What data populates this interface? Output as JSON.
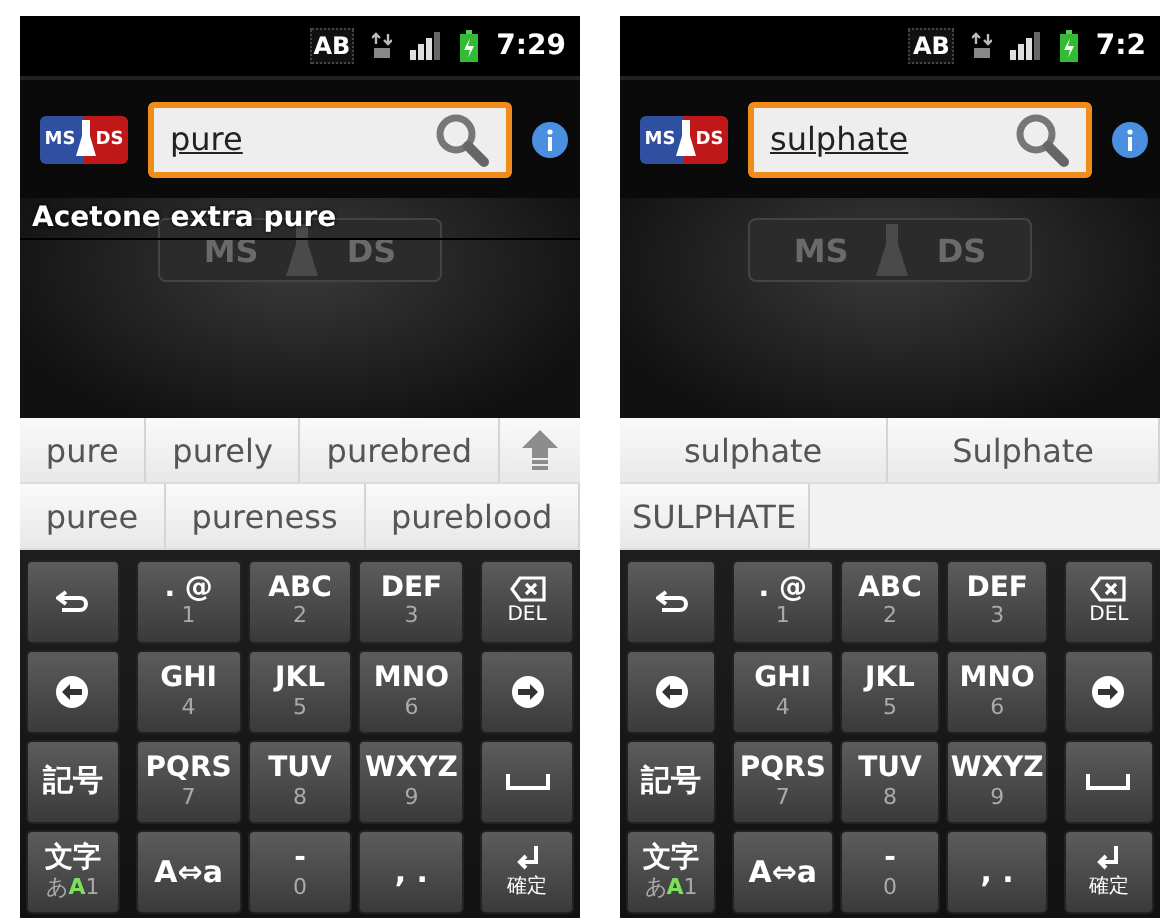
{
  "phones": [
    {
      "status": {
        "input_mode": "AB",
        "time": "7:29"
      },
      "logo": {
        "left": "MS",
        "right": "DS"
      },
      "search": {
        "value": "pure"
      },
      "results": [
        "Acetone extra pure"
      ],
      "background_logo": {
        "left": "MS",
        "right": "DS"
      },
      "suggestions": [
        {
          "words": [
            "pure",
            "purely",
            "purebred"
          ],
          "expand_button": true
        },
        {
          "words": [
            "puree",
            "pureness",
            "pureblood"
          ],
          "expand_button": false
        }
      ],
      "keyboard": [
        [
          {
            "kind": "undo"
          },
          {
            "kind": "char",
            "label": ". @",
            "sub": "1"
          },
          {
            "kind": "char",
            "label": "ABC",
            "sub": "2"
          },
          {
            "kind": "char",
            "label": "DEF",
            "sub": "3"
          },
          {
            "kind": "delete",
            "sub": "DEL"
          }
        ],
        [
          {
            "kind": "left"
          },
          {
            "kind": "char",
            "label": "GHI",
            "sub": "4"
          },
          {
            "kind": "char",
            "label": "JKL",
            "sub": "5"
          },
          {
            "kind": "char",
            "label": "MNO",
            "sub": "6"
          },
          {
            "kind": "right"
          }
        ],
        [
          {
            "kind": "label",
            "label": "記号"
          },
          {
            "kind": "char",
            "label": "PQRS",
            "sub": "7"
          },
          {
            "kind": "char",
            "label": "TUV",
            "sub": "8"
          },
          {
            "kind": "char",
            "label": "WXYZ",
            "sub": "9"
          },
          {
            "kind": "space"
          }
        ],
        [
          {
            "kind": "mode",
            "label": "文字",
            "modes": [
              {
                "text": "あ",
                "selected": false
              },
              {
                "text": "A",
                "selected": true
              },
              {
                "text": "1",
                "selected": false
              }
            ]
          },
          {
            "kind": "label",
            "label": "A⇔a"
          },
          {
            "kind": "char",
            "label": "-",
            "sub": "0"
          },
          {
            "kind": "label",
            "label": ", ."
          },
          {
            "kind": "enter",
            "sub": "確定"
          }
        ]
      ]
    },
    {
      "status": {
        "input_mode": "AB",
        "time": "7:2"
      },
      "logo": {
        "left": "MS",
        "right": "DS"
      },
      "search": {
        "value": "sulphate"
      },
      "background_logo": {
        "left": "MS",
        "right": "DS"
      },
      "suggestions": [
        {
          "words": [
            "sulphate",
            "Sulphate"
          ],
          "expand_button": false
        },
        {
          "words": [
            "SULPHATE"
          ],
          "expand_button": false
        }
      ],
      "keyboard": [
        [
          {
            "kind": "undo"
          },
          {
            "kind": "char",
            "label": ". @",
            "sub": "1"
          },
          {
            "kind": "char",
            "label": "ABC",
            "sub": "2"
          },
          {
            "kind": "char",
            "label": "DEF",
            "sub": "3"
          },
          {
            "kind": "delete",
            "sub": "DEL"
          }
        ],
        [
          {
            "kind": "left"
          },
          {
            "kind": "char",
            "label": "GHI",
            "sub": "4"
          },
          {
            "kind": "char",
            "label": "JKL",
            "sub": "5"
          },
          {
            "kind": "char",
            "label": "MNO",
            "sub": "6"
          },
          {
            "kind": "right"
          }
        ],
        [
          {
            "kind": "label",
            "label": "記号"
          },
          {
            "kind": "char",
            "label": "PQRS",
            "sub": "7"
          },
          {
            "kind": "char",
            "label": "TUV",
            "sub": "8"
          },
          {
            "kind": "char",
            "label": "WXYZ",
            "sub": "9"
          },
          {
            "kind": "space"
          }
        ],
        [
          {
            "kind": "mode",
            "label": "文字",
            "modes": [
              {
                "text": "あ",
                "selected": false
              },
              {
                "text": "A",
                "selected": true
              },
              {
                "text": "1",
                "selected": false
              }
            ]
          },
          {
            "kind": "label",
            "label": "A⇔a"
          },
          {
            "kind": "char",
            "label": "-",
            "sub": "0"
          },
          {
            "kind": "label",
            "label": ", ."
          },
          {
            "kind": "enter",
            "sub": "確定"
          }
        ]
      ]
    }
  ]
}
